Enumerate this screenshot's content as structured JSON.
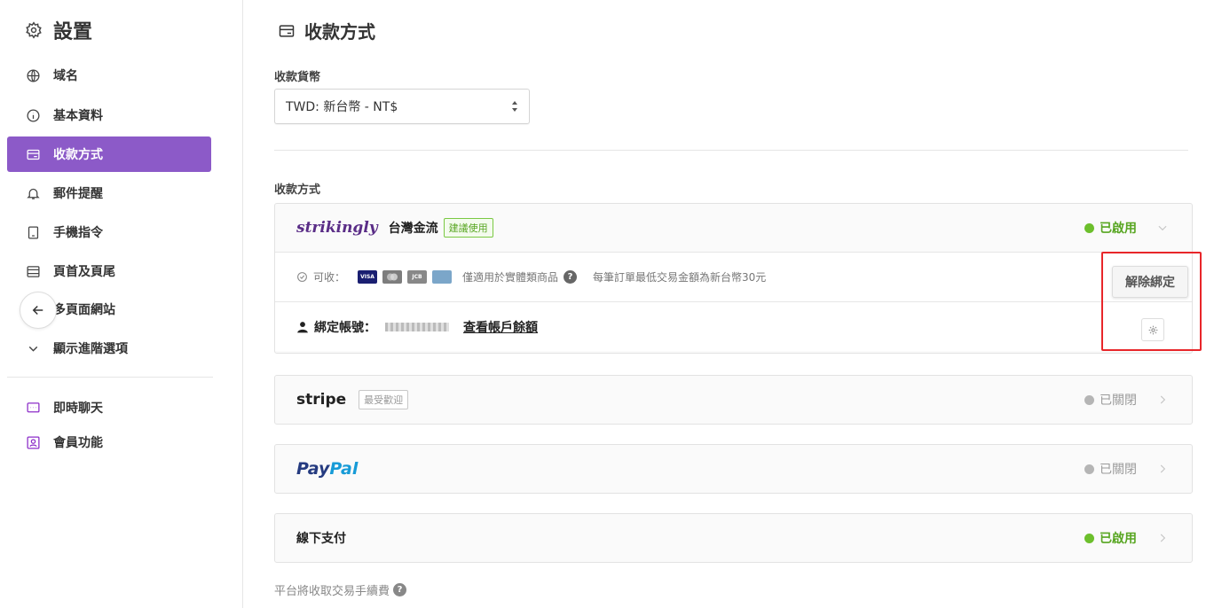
{
  "sidebar": {
    "title": "設置",
    "items": [
      {
        "label": "域名",
        "icon": "globe-icon"
      },
      {
        "label": "基本資料",
        "icon": "info-icon"
      },
      {
        "label": "收款方式",
        "icon": "card-icon",
        "active": true
      },
      {
        "label": "郵件提醒",
        "icon": "bell-icon"
      },
      {
        "label": "手機指令",
        "icon": "phone-icon"
      },
      {
        "label": "頁首及頁尾",
        "icon": "layout-icon"
      },
      {
        "label": "多頁面網站",
        "icon": "pages-icon"
      },
      {
        "label": "顯示進階選項",
        "icon": "chevron-down-icon"
      }
    ],
    "extras": [
      {
        "label": "即時聊天",
        "icon": "chat-icon"
      },
      {
        "label": "會員功能",
        "icon": "member-icon"
      }
    ]
  },
  "main": {
    "title": "收款方式",
    "currency_label": "收款貨幣",
    "currency_value": "TWD: 新台幣 - NT$",
    "methods_label": "收款方式",
    "strikingly": {
      "logo": "strikingly",
      "name": "台灣金流",
      "badge": "建議使用",
      "status": "已啟用",
      "accept_label": "可收：",
      "cards": [
        "VISA",
        "MC",
        "JCB",
        "UnionPay"
      ],
      "physical_note": "僅適用於實體類商品",
      "min_note": "每筆訂單最低交易金額為新台幣30元",
      "account_label": "綁定帳號：",
      "balance_link": "查看帳戶餘額",
      "unbind_button": "解除綁定"
    },
    "stripe": {
      "logo": "stripe",
      "badge": "最受歡迎",
      "status": "已關閉"
    },
    "paypal": {
      "logo_a": "Pay",
      "logo_b": "Pal",
      "status": "已關閉"
    },
    "offline": {
      "name": "線下支付",
      "status": "已啟用"
    },
    "fee_note": "平台將收取交易手續費"
  },
  "colors": {
    "accent": "#8c5ac8",
    "enabled": "#58a622",
    "highlight": "#e8262a"
  }
}
